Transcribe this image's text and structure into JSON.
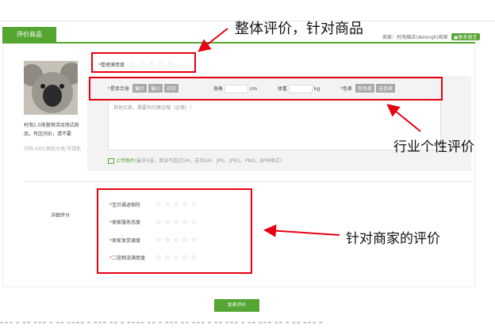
{
  "tab": {
    "label": "评价商品"
  },
  "seller": {
    "text": "卖家：村淘微店(delongh)商家",
    "button": "▣联系留言"
  },
  "product": {
    "title": "村淘1.0淘营销活动测试商品，有区间价，请不要",
    "sku": "尺码:XXS;颜色分类:军绿色"
  },
  "overall": {
    "label": "整理满意度",
    "star": "*",
    "heart_count": 5
  },
  "industry": {
    "fit_label": "是否合身",
    "fit_options": [
      "偏大",
      "偏小",
      "正好"
    ],
    "height_label": "身高",
    "height_unit": "cm",
    "weight_label": "体重",
    "weight_unit": "kg",
    "color_label": "色差",
    "color_options": [
      "有色差",
      "无色差"
    ],
    "comment_placeholder": "其他买家，需要你的建议哦（必填）！",
    "upload_link": "上传图片",
    "upload_hint": "(最多5张，单张不超过5M，支持GIF、JPG、JPEG、PNG、BPM格式)"
  },
  "detail": {
    "label": "详细评分",
    "items": [
      "宝贝描述相符",
      "卖家服务态度",
      "卖家发货速度",
      "二段物流满意度"
    ]
  },
  "submit": {
    "label": "发表评价"
  },
  "annotations": {
    "overall": "整体评价，针对商品",
    "industry": "行业个性评价",
    "seller": "针对商家的评价"
  },
  "footer_strip": "▬▬▬ ▬ ▬▬ ▬▬▬ ▬ ▬▬ ▬▬▬▬ ▬ ▬▬▬ ▬▬ ▬ ▬▬▬▬ ▬▬ ▬ ▬▬▬ ▬▬ ▬▬▬ ▬ ▬▬ ▬▬▬ ▬ ▬▬ ▬▬▬ ▬▬ ▬ ▬▬ ▬▬▬ ▬",
  "colors": {
    "accent": "#55a532",
    "annotation_red": "#e60012"
  }
}
